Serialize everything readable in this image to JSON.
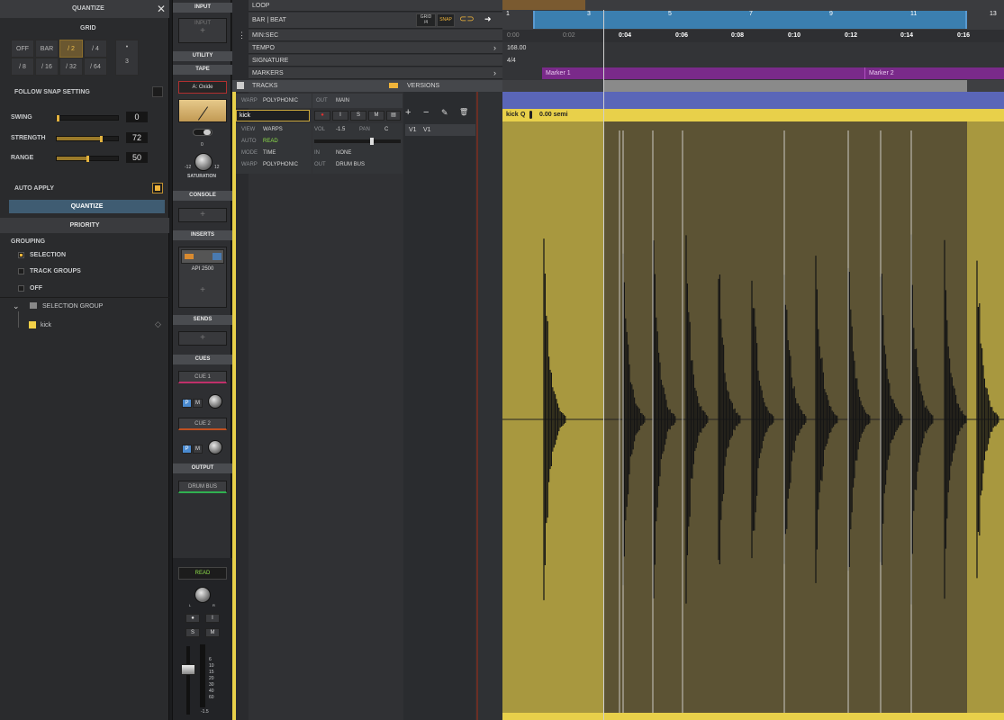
{
  "quantize": {
    "title": "QUANTIZE",
    "grid_label": "GRID",
    "grid_row1": [
      "OFF",
      "BAR",
      "/ 2",
      "/ 4"
    ],
    "grid_row2": [
      "/ 8",
      "/ 16",
      "/ 32",
      "/ 64"
    ],
    "triplet_label": "3",
    "dot_label": "•",
    "follow_snap": "FOLLOW SNAP SETTING",
    "swing_label": "SWING",
    "swing_value": "0",
    "strength_label": "STRENGTH",
    "strength_value": "72",
    "range_label": "RANGE",
    "range_value": "50",
    "auto_apply": "AUTO APPLY",
    "quantize_button": "QUANTIZE",
    "priority": "PRIORITY",
    "grouping": "GROUPING",
    "grouping_options": [
      "SELECTION",
      "TRACK GROUPS",
      "OFF"
    ],
    "selection_group": "SELECTION GROUP",
    "group_item": "kick"
  },
  "strip": {
    "input": "INPUT",
    "input_box": "INPUT",
    "utility": "UTILITY",
    "tape": "TAPE",
    "tape_plugin": "A: Oxide",
    "saturation": "SATURATION",
    "sat_zero": "0",
    "sat_min": "-12",
    "sat_max": "12",
    "console": "CONSOLE",
    "inserts": "INSERTS",
    "insert_plugin": "API 2500",
    "sends": "SENDS",
    "cues": "CUES",
    "cue1": "CUE 1",
    "cue2": "CUE 2",
    "p": "P",
    "m": "M",
    "output": "OUTPUT",
    "output_box": "DRUM BUS",
    "read": "READ",
    "l": "L",
    "r": "R",
    "i": "I",
    "s": "S",
    "fader_value": "-1.5",
    "meter_scale": [
      "6",
      "10",
      "15",
      "20",
      "30",
      "40",
      "60"
    ]
  },
  "header": {
    "loop": "LOOP",
    "bar_beat": "BAR | BEAT",
    "grid": "GRID",
    "grid_val": "/4",
    "snap": "SNAP",
    "min_sec": "MIN:SEC",
    "tempo": "TEMPO",
    "signature": "SIGNATURE",
    "markers": "MARKERS",
    "tracks": "TRACKS",
    "versions": "VERSIONS"
  },
  "track": {
    "warp": "WARP",
    "warp_val": "POLYPHONIC",
    "out": "OUT",
    "out_val": "MAIN",
    "name": "kick",
    "view": "VIEW",
    "view_val": "WARPS",
    "auto": "AUTO",
    "auto_val": "READ",
    "mode": "MODE",
    "mode_val": "TIME",
    "warp2": "WARP",
    "warp2_val": "POLYPHONIC",
    "vol": "VOL",
    "vol_val": "-1.5",
    "pan": "PAN",
    "pan_val": "C",
    "in": "IN",
    "in_val": "NONE",
    "out2": "OUT",
    "out2_val": "DRUM BUS",
    "v1a": "V1",
    "v1b": "V1",
    "i": "I",
    "s": "S",
    "m": "M"
  },
  "timeline": {
    "bars": [
      "1",
      "3",
      "5",
      "7",
      "9",
      "11",
      "13"
    ],
    "times": [
      "0:00",
      "0:02",
      "0:04",
      "0:06",
      "0:08",
      "0:10",
      "0:12",
      "0:14",
      "0:16"
    ],
    "tempo_val": "168.00",
    "sig_val": "4/4",
    "marker1": "Marker 1",
    "marker2": "Marker 2",
    "clip_name": "kick",
    "clip_q": "Q",
    "clip_semi": "0.00 semi"
  },
  "colors": {
    "accent": "#f0b43a",
    "clip": "#b8a442",
    "loop": "#3b7fb0",
    "marker": "#7a2a8a",
    "tracks_lane": "#5a66b8"
  }
}
